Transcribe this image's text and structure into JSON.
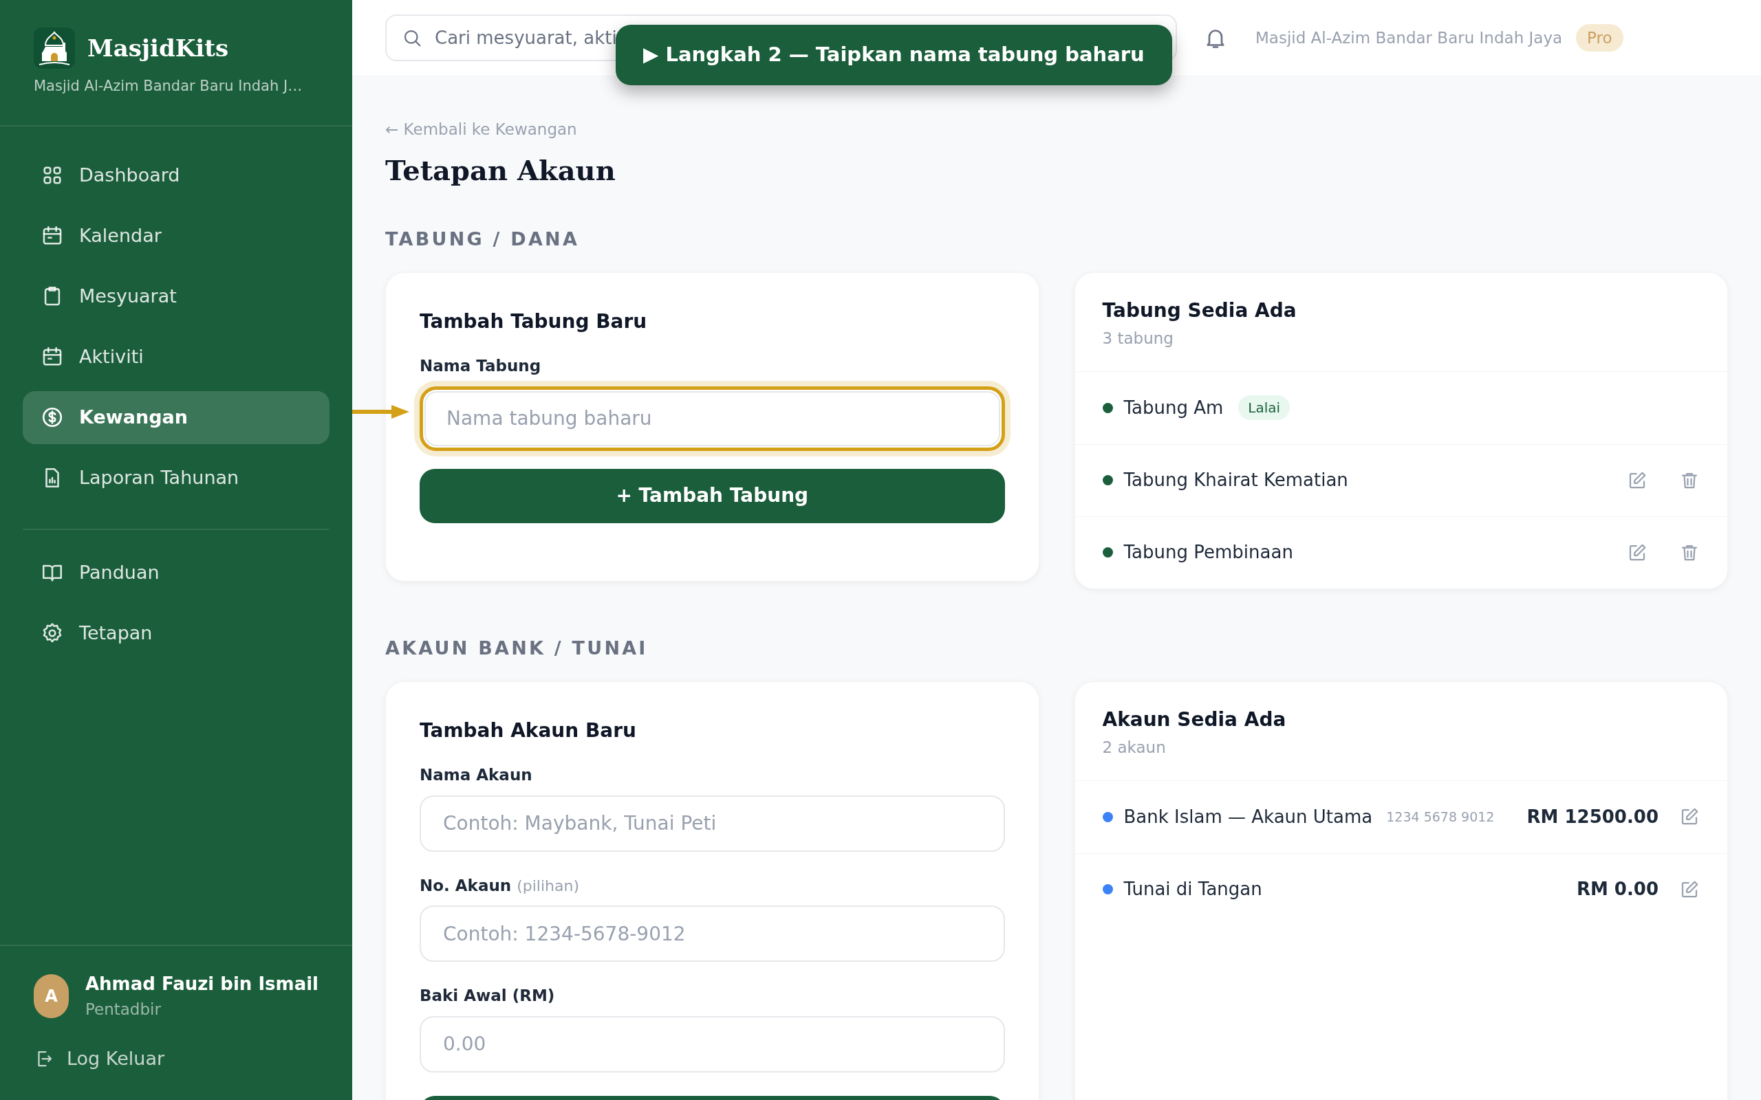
{
  "sidebar": {
    "brand": "MasjidKits",
    "mosque_name": "Masjid Al-Azim Bandar Baru Indah J…",
    "nav_groups": [
      [
        {
          "kind": "grid",
          "label": "Dashboard",
          "selected": false
        },
        {
          "kind": "calendar",
          "label": "Kalendar",
          "selected": false
        },
        {
          "kind": "clipboard",
          "label": "Mesyuarat",
          "selected": false
        },
        {
          "kind": "calendar",
          "label": "Aktiviti",
          "selected": false
        },
        {
          "kind": "dollar",
          "label": "Kewangan",
          "selected": true
        },
        {
          "kind": "report",
          "label": "Laporan Tahunan",
          "selected": false
        }
      ],
      [
        {
          "kind": "book",
          "label": "Panduan",
          "selected": false
        },
        {
          "kind": "gear",
          "label": "Tetapan",
          "selected": false
        }
      ]
    ],
    "user": {
      "initial": "A",
      "name": "Ahmad Fauzi bin Ismail",
      "role": "Pentadbir"
    },
    "logout": "Log Keluar"
  },
  "top_bar": {
    "search": {
      "placeholder": "Cari mesyuarat, akti"
    },
    "mosque_name": "Masjid Al-Azim Bandar Baru Indah Jaya",
    "plan_badge": "Pro"
  },
  "tutorial": {
    "step": "▶ Langkah 2 — Taipkan nama tabung baharu"
  },
  "back_link": "← Kembali ke Kewangan",
  "title": "Tetapan Akaun",
  "sections": [
    {
      "heading": "TABUNG / DANA",
      "form": {
        "title": "Tambah Tabung Baru",
        "fields": [
          {
            "label": "Nama Tabung",
            "placeholder": "Nama tabung baharu",
            "highlighted": true
          }
        ],
        "submit": "+ Tambah Tabung"
      },
      "list": {
        "title": "Tabung Sedia Ada",
        "count": "3 tabung",
        "items": [
          {
            "name": "Tabung Am",
            "color": "#1b5e3b",
            "badge": "Lalai",
            "edit": false,
            "delete": false
          },
          {
            "name": "Tabung Khairat Kematian",
            "color": "#1b5e3b",
            "edit": true,
            "delete": true
          },
          {
            "name": "Tabung Pembinaan",
            "color": "#1b5e3b",
            "edit": true,
            "delete": true
          }
        ]
      }
    },
    {
      "heading": "AKAUN BANK / TUNAI",
      "form": {
        "title": "Tambah Akaun Baru",
        "fields": [
          {
            "label": "Nama Akaun",
            "placeholder": "Contoh: Maybank, Tunai Peti",
            "highlighted": false
          },
          {
            "label": "No. Akaun",
            "hint": "(pilihan)",
            "placeholder": "Contoh: 1234-5678-9012",
            "highlighted": false
          },
          {
            "label": "Baki Awal (RM)",
            "placeholder": "0.00",
            "highlighted": false
          }
        ]
      },
      "list": {
        "title": "Akaun Sedia Ada",
        "count": "2 akaun",
        "items": [
          {
            "name": "Bank Islam — Akaun Utama",
            "number": "1234 5678 9012",
            "balance": "RM 12500.00",
            "color": "#3b82f6",
            "edit": true,
            "delete": false
          },
          {
            "name": "Tunai di Tangan",
            "balance": "RM 0.00",
            "color": "#3b82f6",
            "edit": true,
            "delete": false
          }
        ]
      }
    }
  ]
}
